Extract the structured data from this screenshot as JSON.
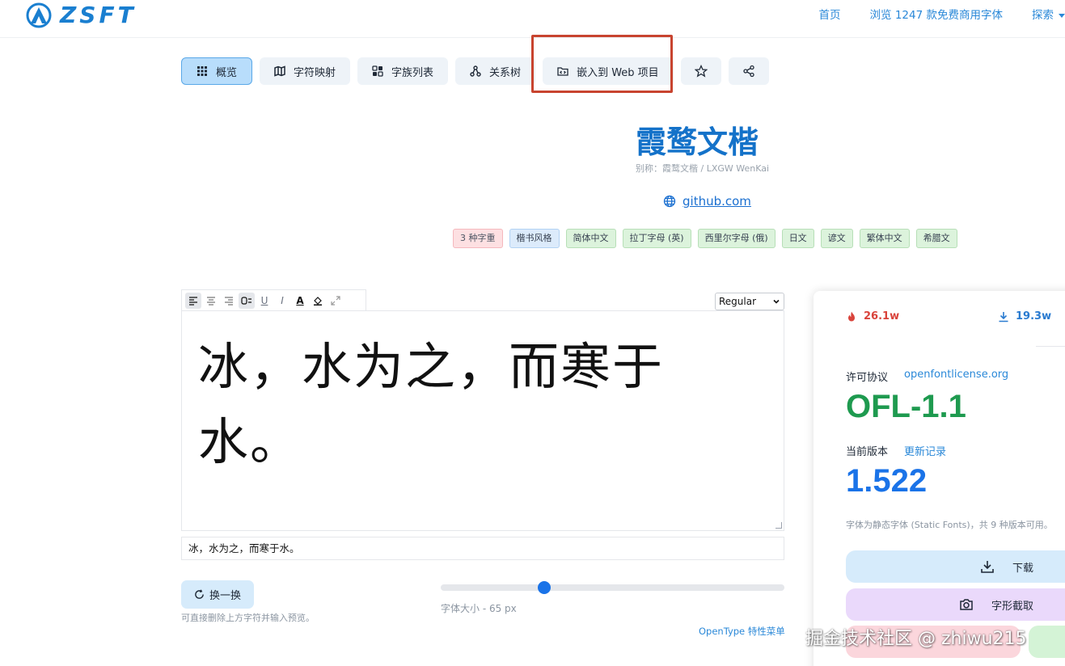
{
  "header": {
    "brand": "ZSFT",
    "nav": [
      {
        "label": "首页"
      },
      {
        "label": "浏览 1247 款免费商用字体"
      },
      {
        "label": "探索"
      }
    ]
  },
  "toolbar": {
    "tabs": [
      {
        "label": "概览",
        "icon": "grid-icon",
        "active": true
      },
      {
        "label": "字符映射",
        "icon": "map-icon"
      },
      {
        "label": "字族列表",
        "icon": "glyph-list-icon"
      },
      {
        "label": "关系树",
        "icon": "tree-icon"
      },
      {
        "label": "嵌入到 Web 项目",
        "icon": "folder-code-icon"
      }
    ],
    "favorite_icon": "star-icon",
    "share_icon": "share-icon"
  },
  "font": {
    "title": "霞鹜文楷",
    "alias": "别称：霞鹜文楷 / LXGW WenKai",
    "homepage": "github.com",
    "tags": [
      {
        "label": "3 种字重",
        "color": "#fde0e2"
      },
      {
        "label": "楷书风格",
        "color": "#dcebfb"
      },
      {
        "label": "简体中文",
        "color": "#dcf3dc"
      },
      {
        "label": "拉丁字母 (英)",
        "color": "#dcf3dc"
      },
      {
        "label": "西里尔字母 (俄)",
        "color": "#dcf3dc"
      },
      {
        "label": "日文",
        "color": "#dcf3dc"
      },
      {
        "label": "谚文",
        "color": "#dcf3dc"
      },
      {
        "label": "繁体中文",
        "color": "#dcf3dc"
      },
      {
        "label": "希腊文",
        "color": "#dcf3dc"
      }
    ]
  },
  "editor": {
    "weight_selected": "Regular",
    "preview_text": "冰，水为之，而寒于水。",
    "input_value": "冰，水为之，而寒于水。",
    "shuffle_label": "换一换",
    "hint": "可直接删除上方字符并输入预览。",
    "font_size_label": "字体大小 - 65 px",
    "font_size_fraction": 0.3,
    "opentype_prefix": "OpenType",
    "opentype_link": "特性菜单"
  },
  "panel": {
    "views": "26.1w",
    "downloads": "19.3w",
    "license_label": "许可协议",
    "license_link": "openfontlicense.org",
    "license_value": "OFL-1.1",
    "version_label": "当前版本",
    "version_link": "更新记录",
    "version_value": "1.522",
    "static_note": "字体为静态字体 (Static Fonts)，共 9 种版本可用。",
    "download_label": "下载",
    "capture_label": "字形截取"
  },
  "watermark": "掘金技术社区 @ zhiwu215",
  "colors": {
    "accent": "#1a73e8",
    "link": "#2a88d8",
    "license_green": "#1e9a4f",
    "title_blue": "#1472c9",
    "highlight_red": "#c8442f"
  }
}
